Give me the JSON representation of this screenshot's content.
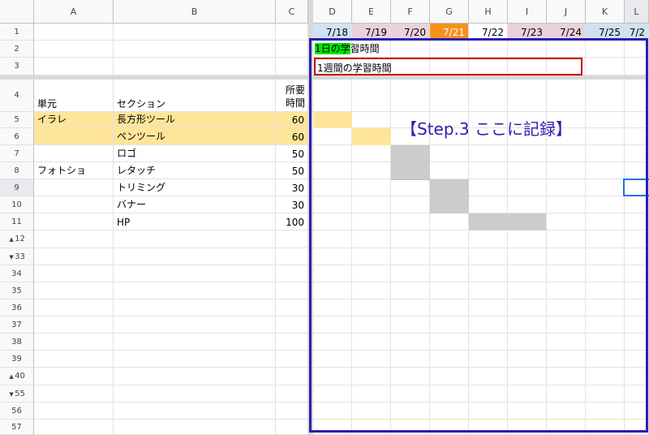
{
  "columns": [
    "A",
    "B",
    "C",
    "D",
    "E",
    "F",
    "G",
    "H",
    "I",
    "J",
    "K",
    "L"
  ],
  "rows_visible": [
    "1",
    "2",
    "3",
    "4",
    "5",
    "6",
    "7",
    "8",
    "9",
    "10",
    "11",
    "12",
    "33",
    "34",
    "35",
    "36",
    "37",
    "38",
    "39",
    "40",
    "55",
    "56",
    "57"
  ],
  "header_row": {
    "unit": "単元",
    "section": "セクション",
    "time_line1": "所要",
    "time_line2": "時間"
  },
  "dates": [
    "7/18",
    "7/19",
    "7/20",
    "7/21",
    "7/22",
    "7/23",
    "7/24",
    "7/25",
    "7/2"
  ],
  "date_colors": [
    "#cfe2f3",
    "#ead1dc",
    "#ead1dc",
    "#f6911e",
    "#ffffff",
    "#ead1dc",
    "#ead1dc",
    "#cfe2f3",
    "#cfe2f3"
  ],
  "row2_label_green": "1日の学",
  "row2_label_rest": "習時間",
  "row3_label": "1週間の学習時間",
  "tasks": [
    {
      "unit": "イラレ",
      "section": "長方形ツール",
      "time": "60"
    },
    {
      "unit": "",
      "section": "ペンツール",
      "time": "60"
    },
    {
      "unit": "",
      "section": "ロゴ",
      "time": "50"
    },
    {
      "unit": "フォトショ",
      "section": "レタッチ",
      "time": "50"
    },
    {
      "unit": "",
      "section": "トリミング",
      "time": "30"
    },
    {
      "unit": "",
      "section": "バナー",
      "time": "30"
    },
    {
      "unit": "",
      "section": "HP",
      "time": "100"
    }
  ],
  "step_note": "【Step.3 ここに記録】",
  "colors": {
    "highlight_yellow": "#ffe599",
    "gantt_gray": "#cccccc",
    "blue_border": "#2b1fb0",
    "red_border": "#c00000",
    "green": "#00e600",
    "orange_date": "#f6911e"
  }
}
